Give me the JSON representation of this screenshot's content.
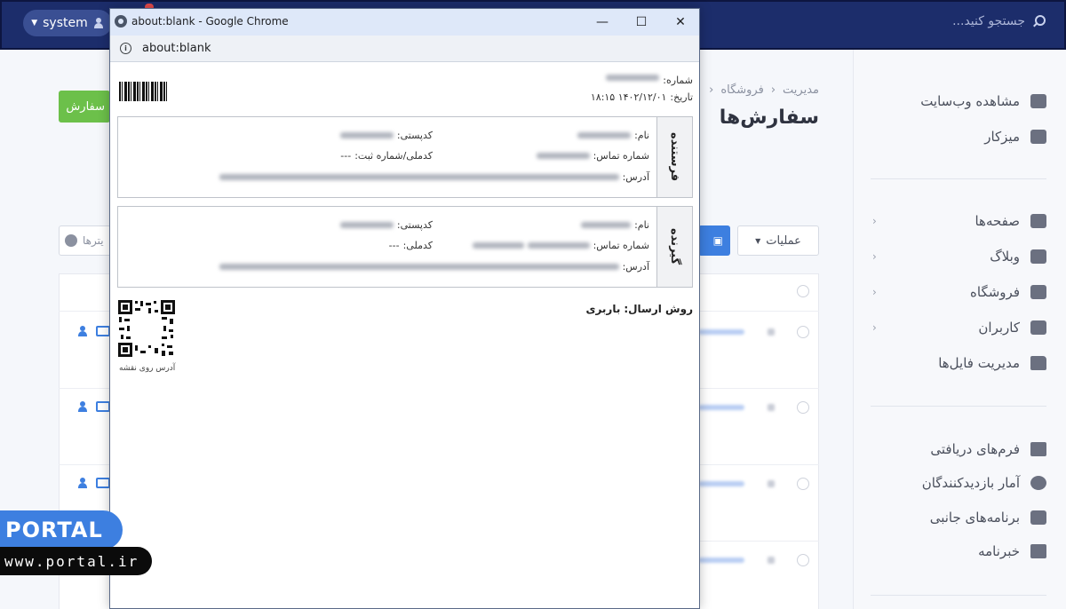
{
  "app": {
    "user_label": "system",
    "search_placeholder": "جستجو کنید...",
    "breadcrumb": [
      "مدیریت",
      "فروشگاه"
    ],
    "page_title": "سفارش‌ها",
    "add_order_label": "سفارش",
    "operations_label": "عملیات",
    "filter_label": "یترها",
    "sidebar": {
      "top": [
        {
          "label": "مشاهده وب‌سایت",
          "icon": "external-link-icon"
        },
        {
          "label": "میزکار",
          "icon": "home-icon"
        }
      ],
      "mid": [
        {
          "label": "صفحه‌ها",
          "icon": "pages-icon"
        },
        {
          "label": "وبلاگ",
          "icon": "pencil-icon"
        },
        {
          "label": "فروشگاه",
          "icon": "cart-icon"
        },
        {
          "label": "کاربران",
          "icon": "users-icon"
        },
        {
          "label": "مدیریت فایل‌ها",
          "icon": "folder-icon"
        }
      ],
      "bottom": [
        {
          "label": "فرم‌های دریافتی",
          "icon": "envelope-icon"
        },
        {
          "label": "آمار بازدیدکنندگان",
          "icon": "pie-chart-icon"
        },
        {
          "label": "برنامه‌های جانبی",
          "icon": "plug-icon"
        },
        {
          "label": "خبرنامه",
          "icon": "newspaper-icon"
        }
      ]
    }
  },
  "window": {
    "title": "about:blank - Google Chrome",
    "url": "about:blank",
    "minimize": "—",
    "maximize": "☐",
    "close": "✕"
  },
  "invoice": {
    "number_label": "شماره:",
    "date_label": "تاریخ:",
    "date_value": "۱۴۰۲/۱۲/۰۱ ۱۸:۱۵",
    "sender": {
      "heading": "فرستنده",
      "name_label": "نام:",
      "postal_label": "کدپستی:",
      "phone_label": "شماره تماس:",
      "national_label": "کدملی/شماره ثبت:",
      "national_value": "---",
      "address_label": "آدرس:"
    },
    "receiver": {
      "heading": "گیرنده",
      "name_label": "نام:",
      "postal_label": "کدپستی:",
      "phone_label": "شماره تماس:",
      "national_label": "کدملی:",
      "national_value": "---",
      "address_label": "آدرس:"
    },
    "shipping_label": "روش ارسال:",
    "shipping_value": "باربری",
    "qr_caption": "آدرس روی نقشه"
  },
  "watermark": {
    "brand": "PORTAL",
    "url": "www.portal.ir"
  },
  "colors": {
    "topbar": "#1c2d6b",
    "accent_blue": "#3d7fe0",
    "accent_green": "#6cc04a"
  }
}
